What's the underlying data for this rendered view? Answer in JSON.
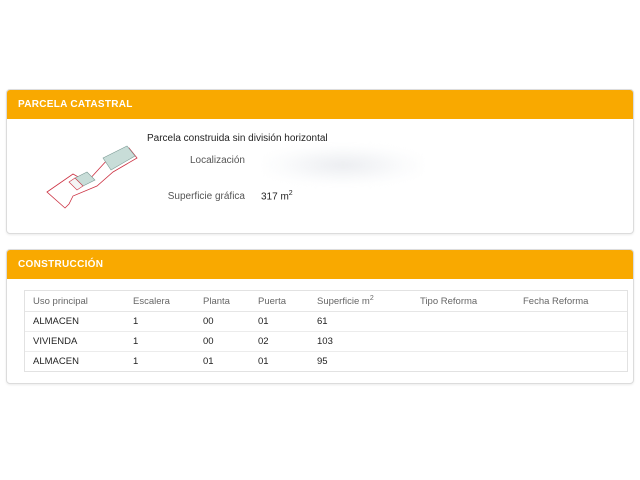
{
  "parcela": {
    "header": "PARCELA CATASTRAL",
    "description": "Parcela construida sin división horizontal",
    "localizacion_label": "Localización",
    "superficie_label": "Superficie gráfica",
    "superficie_value": "317 m",
    "superficie_unit_sup": "2"
  },
  "construccion": {
    "header": "CONSTRUCCIÓN",
    "columns": [
      "Uso principal",
      "Escalera",
      "Planta",
      "Puerta",
      "Superficie m",
      "Tipo Reforma",
      "Fecha Reforma"
    ],
    "superficie_sup": "2",
    "rows": [
      [
        "ALMACEN",
        "1",
        "00",
        "01",
        "61",
        "",
        ""
      ],
      [
        "VIVIENDA",
        "1",
        "00",
        "02",
        "103",
        "",
        ""
      ],
      [
        "ALMACEN",
        "1",
        "01",
        "01",
        "95",
        "",
        ""
      ]
    ]
  },
  "colors": {
    "header_bg": "#f9a900",
    "parcel_fill": "#c8ddd8",
    "parcel_outline": "#cc3344"
  }
}
